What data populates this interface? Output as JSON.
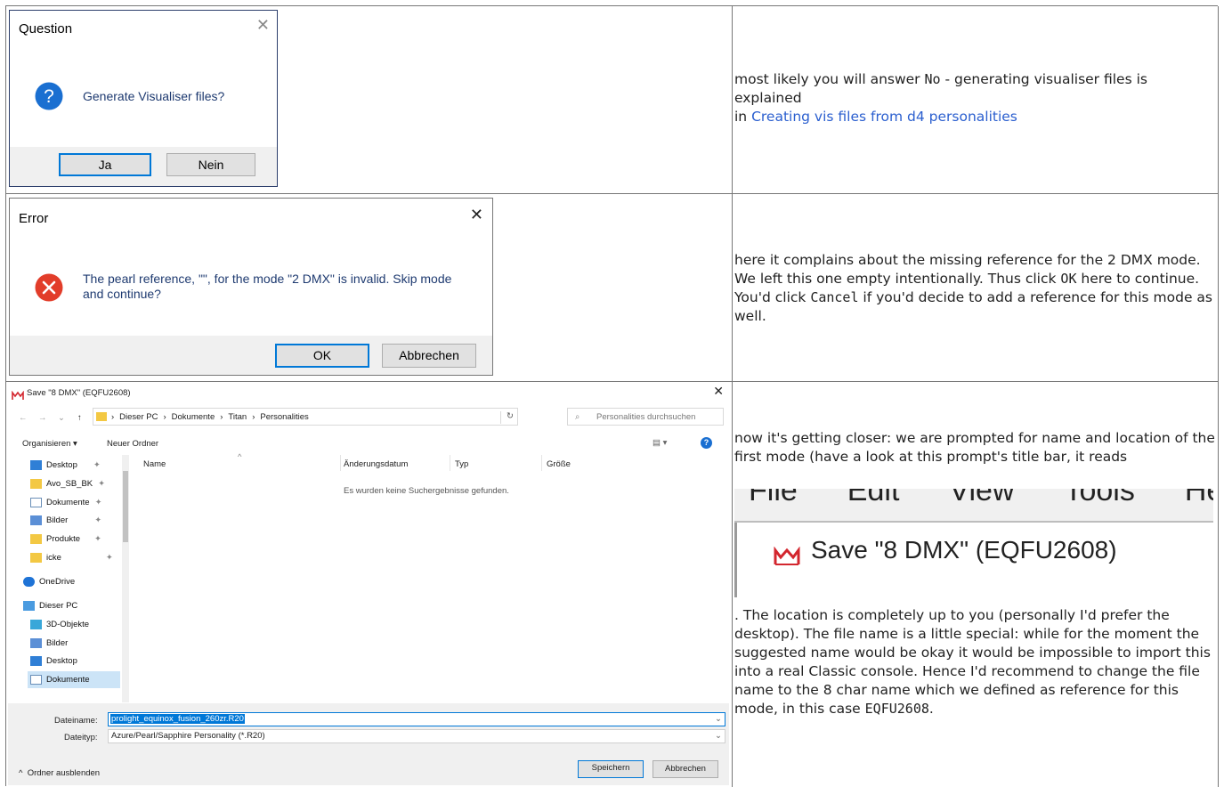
{
  "question_dialog": {
    "title": "Question",
    "message": "Generate Visualiser files?",
    "yes_label": "Ja",
    "no_label": "Nein"
  },
  "row1_text": {
    "line1_pre": "most likely you will answer ",
    "line1_code": "No",
    "line1_post": " - generating visualiser files is explained",
    "line2_pre": "in ",
    "link": "Creating vis files from d4 personalities"
  },
  "error_dialog": {
    "title": "Error",
    "message": "The pearl reference, \"\", for the mode \"2 DMX\" is invalid. Skip mode and continue?",
    "ok_label": "OK",
    "cancel_label": "Abbrechen"
  },
  "row2_text": {
    "t1": "here it complains about the missing reference for the 2 DMX mode. We left this one empty intentionally. Thus click ",
    "code1": "OK",
    "t2": " here to continue. You'd click ",
    "code2": "Cancel",
    "t3": " if you'd decide to add a reference for this mode as well."
  },
  "save_dialog": {
    "title": "Save \"8 DMX\" (EQFU2608)",
    "breadcrumb": [
      "Dieser PC",
      "Dokumente",
      "Titan",
      "Personalities"
    ],
    "search_placeholder": "Personalities durchsuchen",
    "organize": "Organisieren",
    "new_folder": "Neuer Ordner",
    "nav_items": [
      {
        "label": "Desktop",
        "icon": "folder-blue-icon"
      },
      {
        "label": "Avo_SB_BK",
        "icon": "folder-icon"
      },
      {
        "label": "Dokumente",
        "icon": "document-icon"
      },
      {
        "label": "Bilder",
        "icon": "pictures-icon"
      },
      {
        "label": "Produkte",
        "icon": "folder-icon"
      },
      {
        "label": "icke",
        "icon": "folder-icon"
      },
      {
        "label": "OneDrive",
        "icon": "cloud-icon"
      },
      {
        "label": "Dieser PC",
        "icon": "computer-icon"
      },
      {
        "label": "3D-Objekte",
        "icon": "cube-icon"
      },
      {
        "label": "Bilder",
        "icon": "pictures-icon"
      },
      {
        "label": "Desktop",
        "icon": "folder-blue-icon"
      },
      {
        "label": "Dokumente",
        "icon": "document-icon"
      }
    ],
    "columns": [
      "Name",
      "Änderungsdatum",
      "Typ",
      "Größe"
    ],
    "empty_message": "Es wurden keine Suchergebnisse gefunden.",
    "filename_label": "Dateiname:",
    "filename_value": "prolight_equinox_fusion_260zr.R20",
    "filetype_label": "Dateityp:",
    "filetype_value": "Azure/Pearl/Sapphire Personality (*.R20)",
    "hide_folders": "Ordner ausblenden",
    "save_label": "Speichern",
    "cancel_label": "Abbrechen"
  },
  "row3_text": {
    "intro": "now it's getting closer: we are prompted for name and location of the first mode (have a look at this prompt's title bar, it reads",
    "zoom_menu": [
      "File",
      "Edit",
      "View",
      "Tools",
      "Help"
    ],
    "zoom_title": "Save \"8 DMX\" (EQFU2608)",
    "rest": ". The location is completely up to you (personally I'd prefer the desktop). The file name is a little special: while for the moment the suggested name would be okay it would be impossible to import this into a real Classic console. Hence I'd recommend to change the file name to the 8 char name which we defined as reference for this mode, in this case ",
    "code": "EQFU2608",
    "end": "."
  }
}
